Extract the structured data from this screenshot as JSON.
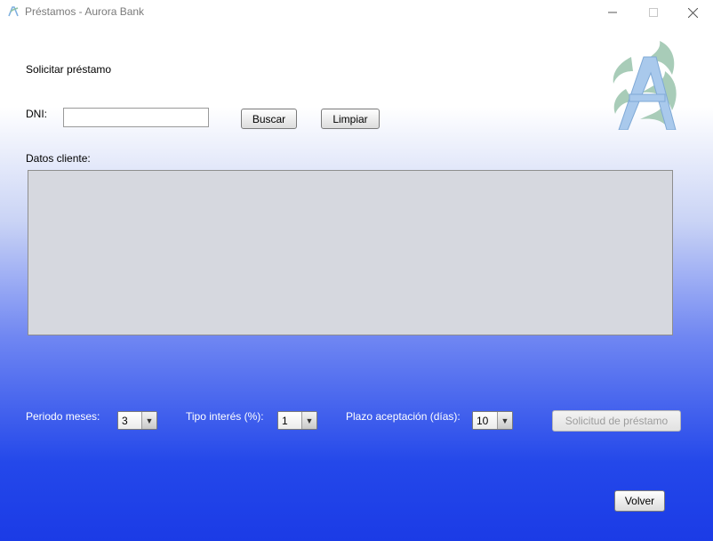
{
  "window": {
    "title": "Préstamos - Aurora Bank"
  },
  "form": {
    "heading": "Solicitar préstamo",
    "dni_label": "DNI:",
    "dni_value": "",
    "search_button": "Buscar",
    "clear_button": "Limpiar",
    "client_data_label": "Datos cliente:",
    "client_data_value": ""
  },
  "loan_options": {
    "period_label": "Periodo meses:",
    "period_value": "3",
    "interest_label": "Tipo interés (%):",
    "interest_value": "1",
    "acceptance_label": "Plazo aceptación (días):",
    "acceptance_value": "10",
    "request_button": "Solicitud de préstamo",
    "request_button_enabled": false
  },
  "footer": {
    "back_button": "Volver"
  },
  "icons": {
    "app": "aurora-bank-app-icon",
    "minimize": "minimize-icon",
    "maximize": "maximize-icon",
    "close": "close-icon",
    "logo": "aurora-bank-logo",
    "dropdown": "chevron-down-icon"
  },
  "colors": {
    "gradient_top": "#ffffff",
    "gradient_bottom": "#1b3be6",
    "data_area_bg": "#d6d8df",
    "logo_green": "#a8ccb8",
    "logo_blue": "#a9c9ec"
  }
}
